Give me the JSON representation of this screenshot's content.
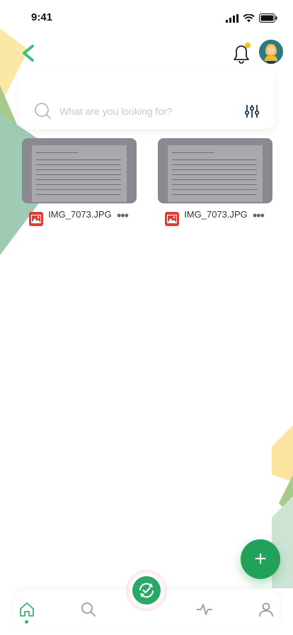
{
  "status_bar": {
    "time": "9:41"
  },
  "search": {
    "placeholder": "What are you looking for?"
  },
  "files": [
    {
      "name": "IMG_7073.JPG",
      "icon": "image-icon"
    },
    {
      "name": "IMG_7073.JPG",
      "icon": "image-icon"
    }
  ],
  "fab": {
    "label": "+"
  },
  "colors": {
    "accent": "#22a15a",
    "back_arrow": "#3bbf7a",
    "notification_dot": "#f5c518",
    "file_icon": "#e23b31"
  },
  "nav": {
    "items": [
      "home-icon",
      "search-icon",
      "sync-check-icon",
      "activity-icon",
      "profile-icon"
    ]
  }
}
